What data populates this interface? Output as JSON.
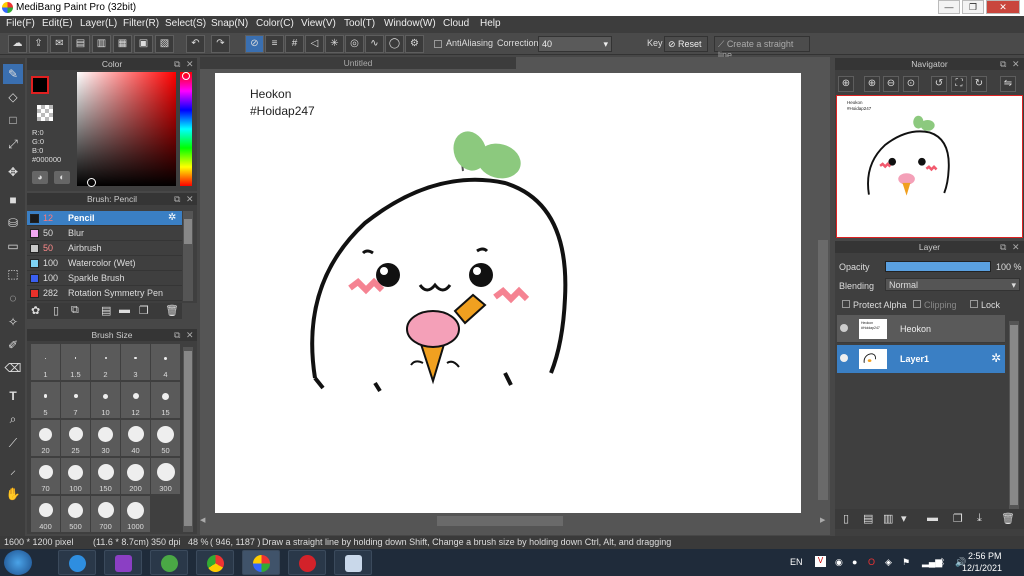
{
  "window": {
    "title": "MediBang Paint Pro (32bit)",
    "minimize": "—",
    "restore": "❐",
    "close": "✕"
  },
  "menu": [
    "File(F)",
    "Edit(E)",
    "Layer(L)",
    "Filter(R)",
    "Select(S)",
    "Snap(N)",
    "Color(C)",
    "View(V)",
    "Tool(T)",
    "Window(W)",
    "Cloud",
    "Help"
  ],
  "toolbar": {
    "antialiasing_label": "AntiAliasing",
    "correction_label": "Correction",
    "correction_value": "40",
    "key_label": "Key",
    "reset_label": "Reset",
    "straight_line_label": "Create a straight line"
  },
  "color_panel": {
    "title": "Color",
    "r": "R:0",
    "g": "G:0",
    "b": "B:0",
    "hex": "#000000",
    "current_color": "#000000"
  },
  "brush_panel": {
    "title": "Brush: Pencil",
    "items": [
      {
        "size": "12",
        "name": "Pencil",
        "swatch": "#1a1a1a"
      },
      {
        "size": "50",
        "name": "Blur",
        "swatch": "#f2a8f2"
      },
      {
        "size": "50",
        "name": "Airbrush",
        "swatch": "#c8c8c8"
      },
      {
        "size": "100",
        "name": "Watercolor (Wet)",
        "swatch": "#7fd4f5"
      },
      {
        "size": "100",
        "name": "Sparkle Brush",
        "swatch": "#3a5ff0"
      },
      {
        "size": "282",
        "name": "Rotation Symmetry Pen",
        "swatch": "#e8312b"
      }
    ]
  },
  "brush_size_panel": {
    "title": "Brush Size",
    "sizes": [
      "1",
      "1.5",
      "2",
      "3",
      "4",
      "5",
      "7",
      "10",
      "12",
      "15",
      "20",
      "25",
      "30",
      "40",
      "50",
      "70",
      "100",
      "150",
      "200",
      "300",
      "400",
      "500",
      "700",
      "1000"
    ]
  },
  "document": {
    "tab_title": "Untitled",
    "text_line1": "Heokon",
    "text_line2": "#Hoidap247"
  },
  "navigator": {
    "title": "Navigator",
    "thumb_line1": "Heokon",
    "thumb_line2": "#Hoidap247"
  },
  "layer_panel": {
    "title": "Layer",
    "opacity_label": "Opacity",
    "opacity_value": "100 %",
    "opacity_fraction": 1.0,
    "blending_label": "Blending",
    "blending_value": "Normal",
    "protect_alpha": "Protect Alpha",
    "clipping": "Clipping",
    "lock": "Lock",
    "layers": [
      {
        "name": "Heokon",
        "thumb": "Heokon #Hoidap247"
      },
      {
        "name": "Layer1"
      }
    ]
  },
  "status": {
    "size": "1600 * 1200 pixel",
    "cm": "(11.6 * 8.7cm)",
    "dpi": "350 dpi",
    "zoom": "48 %",
    "coords": "( 946, 1187 )",
    "hint": "Draw a straight line by holding down Shift, Change a brush size by holding down Ctrl, Alt, and dragging"
  },
  "taskbar": {
    "lang": "EN",
    "time": "2:56 PM",
    "date": "12/1/2021"
  },
  "colors": {
    "accent": "#3a7fc4",
    "leaf": "#8cc97e",
    "blush": "#f25a6e",
    "carrot": "#f0a020",
    "icecream": "#f4a0b8"
  }
}
